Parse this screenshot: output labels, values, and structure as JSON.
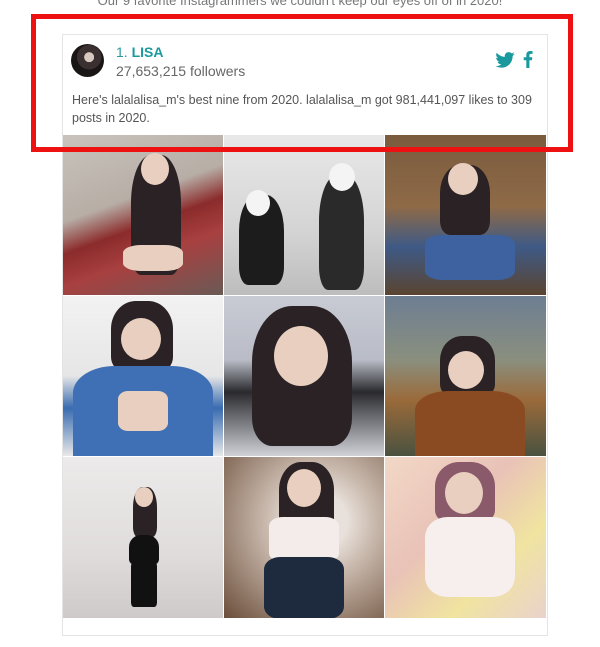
{
  "top_caption": "Our 9 favorite Instagrammers we couldn't keep our eyes off of in 2020!",
  "profile": {
    "rank": "1.",
    "name": "LISA",
    "followers": "27,653,215 followers",
    "description": "Here's lalalalisa_m's best nine from 2020. lalalalisa_m got 981,441,097 likes to 309 posts in 2020."
  },
  "social": {
    "twitter_icon": "twitter-icon",
    "facebook_icon": "facebook-icon",
    "twitter_color": "#1DA1F2",
    "facebook_color": "#1a9a9e"
  },
  "photos": [
    {
      "name": "photo-1"
    },
    {
      "name": "photo-2"
    },
    {
      "name": "photo-3"
    },
    {
      "name": "photo-4"
    },
    {
      "name": "photo-5"
    },
    {
      "name": "photo-6"
    },
    {
      "name": "photo-7"
    },
    {
      "name": "photo-8"
    },
    {
      "name": "photo-9"
    }
  ],
  "highlight_color": "#ee1111"
}
